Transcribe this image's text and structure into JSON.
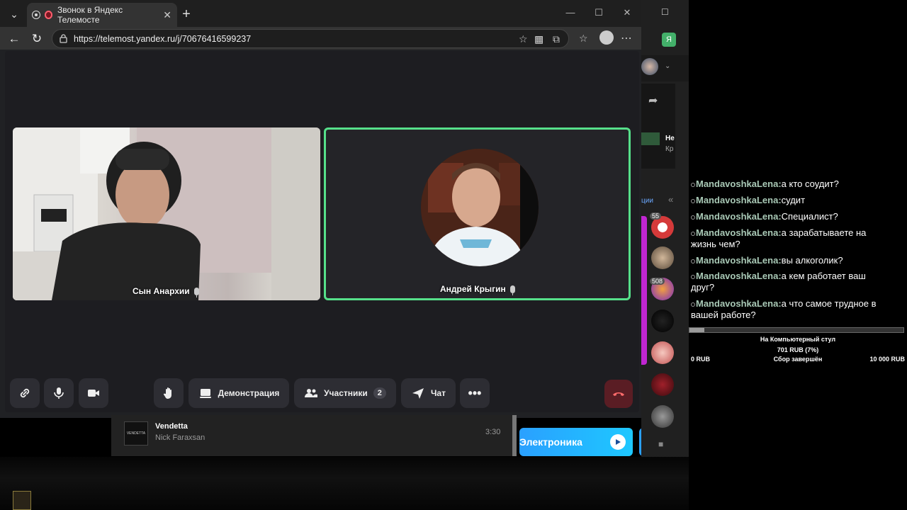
{
  "browser": {
    "tab_title": "Звонок в Яндекс Телемосте",
    "url": "https://telemost.yandex.ru/j/70676416599237",
    "profile_letter": "Я"
  },
  "meeting": {
    "participants": [
      {
        "name": "Сын Анархии"
      },
      {
        "name": "Андрей Крыгин"
      }
    ],
    "controls": {
      "demo_label": "Демонстрация",
      "participants_label": "Участники",
      "participants_count": "2",
      "chat_label": "Чат"
    },
    "active_speaker_color": "#56e08a",
    "hangup_color": "#5a1d24"
  },
  "music": {
    "track_title": "Vendetta",
    "artist": "Nick Faraxsan",
    "duration": "3:30",
    "thumb_text": "VENDETTA",
    "genre_label": "Электроника"
  },
  "side_strip": {
    "partial_title": "Не",
    "partial_sub": "Кр",
    "partial_link": "ции",
    "badge_55": "55",
    "badge_508": "508"
  },
  "stream_chat": {
    "messages": [
      {
        "user": "MandavoshkaLena:",
        "text": "а кто соудит?"
      },
      {
        "user": "MandavoshkaLena:",
        "text": "судит"
      },
      {
        "user": "MandavoshkaLena:",
        "text": "Специалист?"
      },
      {
        "user": "MandavoshkaLena:",
        "text": "а зарабатываете на",
        "text2": "жизнь чем?"
      },
      {
        "user": "MandavoshkaLena:",
        "text": "вы алкоголик?"
      },
      {
        "user": "MandavoshkaLena:",
        "text": "а кем работает ваш",
        "text2": "друг?"
      },
      {
        "user": "MandavoshkaLena:",
        "text": "а что самое трудное в",
        "text2": "вашей работе?"
      }
    ]
  },
  "donation": {
    "goal_title": "На Компьютерный стул",
    "raised": "701 RUB (7%)",
    "min": "0 RUB",
    "status": "Сбор завершён",
    "max": "10 000 RUB",
    "progress_percent": 7
  }
}
